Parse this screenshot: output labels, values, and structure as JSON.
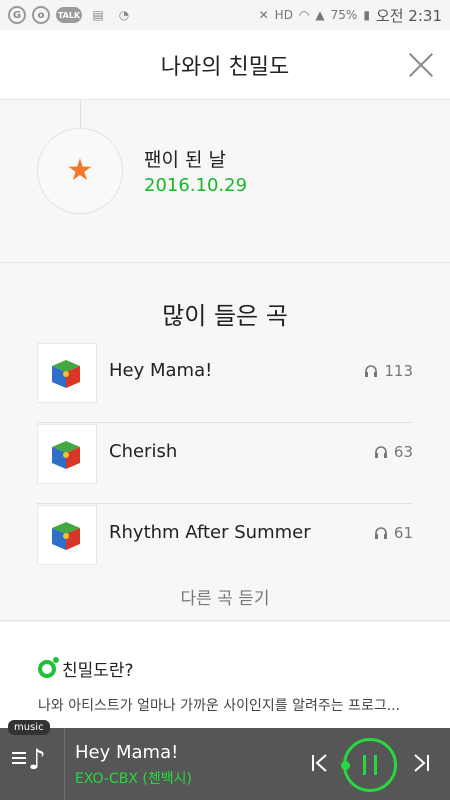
{
  "status_bar": {
    "battery": "75%",
    "time": "오전 2:31",
    "hd_label": "HD",
    "icons": [
      "circle-o-icon",
      "talk-icon",
      "memo-icon",
      "messenger-icon",
      "mute-icon",
      "wifi-icon",
      "signal-icon",
      "battery-icon"
    ]
  },
  "header": {
    "title": "나와의 친밀도"
  },
  "fan": {
    "label": "팬이 된 날",
    "date": "2016.10.29",
    "icon": "star-icon"
  },
  "songs": {
    "title": "많이 들은 곡",
    "items": [
      {
        "title": "Hey Mama!",
        "plays": "113"
      },
      {
        "title": "Cherish",
        "plays": "63"
      },
      {
        "title": "Rhythm After Summer",
        "plays": "61"
      }
    ],
    "more_label": "다른 곡 듣기"
  },
  "about": {
    "title": "친밀도란?",
    "text": "나와 아티스트가 얼마나 가까운 사이인지를 알려주는 프로그..."
  },
  "player": {
    "tag": "music",
    "title": "Hey Mama!",
    "artist": "EXO-CBX (첸백시)"
  },
  "colors": {
    "accent": "#16b82a",
    "star": "#f5782b",
    "player_bg": "#565656"
  }
}
